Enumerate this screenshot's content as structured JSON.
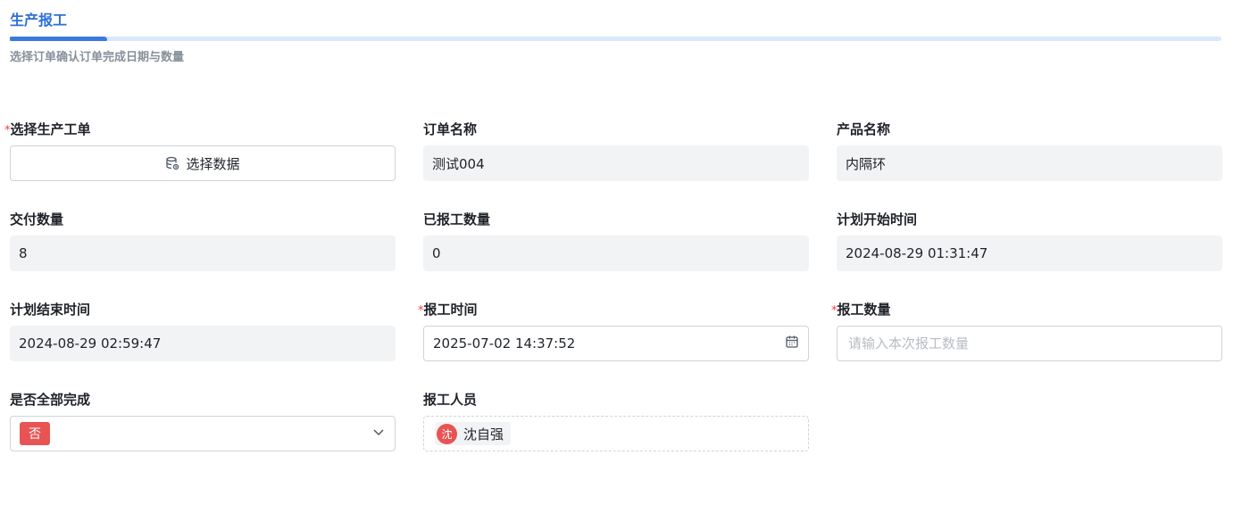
{
  "header": {
    "title": "生产报工",
    "progress": 0.08,
    "subtitle": "选择订单确认订单完成日期与数量"
  },
  "colors": {
    "accent": "#3a79e0",
    "required": "#f53f3f",
    "tag_red": "#e85454"
  },
  "form": {
    "order_select": {
      "label": "选择生产工单",
      "required": true,
      "button_label": "选择数据",
      "icon": "database-icon"
    },
    "order_name": {
      "label": "订单名称",
      "value": "测试004"
    },
    "product_name": {
      "label": "产品名称",
      "value": "内隔环"
    },
    "delivery_qty": {
      "label": "交付数量",
      "value": "8"
    },
    "reported_qty": {
      "label": "已报工数量",
      "value": "0"
    },
    "plan_start": {
      "label": "计划开始时间",
      "value": "2024-08-29 01:31:47"
    },
    "plan_end": {
      "label": "计划结束时间",
      "value": "2024-08-29 02:59:47"
    },
    "report_time": {
      "label": "报工时间",
      "required": true,
      "value": "2025-07-02 14:37:52",
      "icon": "calendar-icon"
    },
    "report_qty": {
      "label": "报工数量",
      "required": true,
      "placeholder": "请输入本次报工数量"
    },
    "all_complete": {
      "label": "是否全部完成",
      "value": "否",
      "icon": "chevron-down-icon"
    },
    "reporter": {
      "label": "报工人员",
      "avatar_text": "沈",
      "name": "沈自强"
    }
  }
}
